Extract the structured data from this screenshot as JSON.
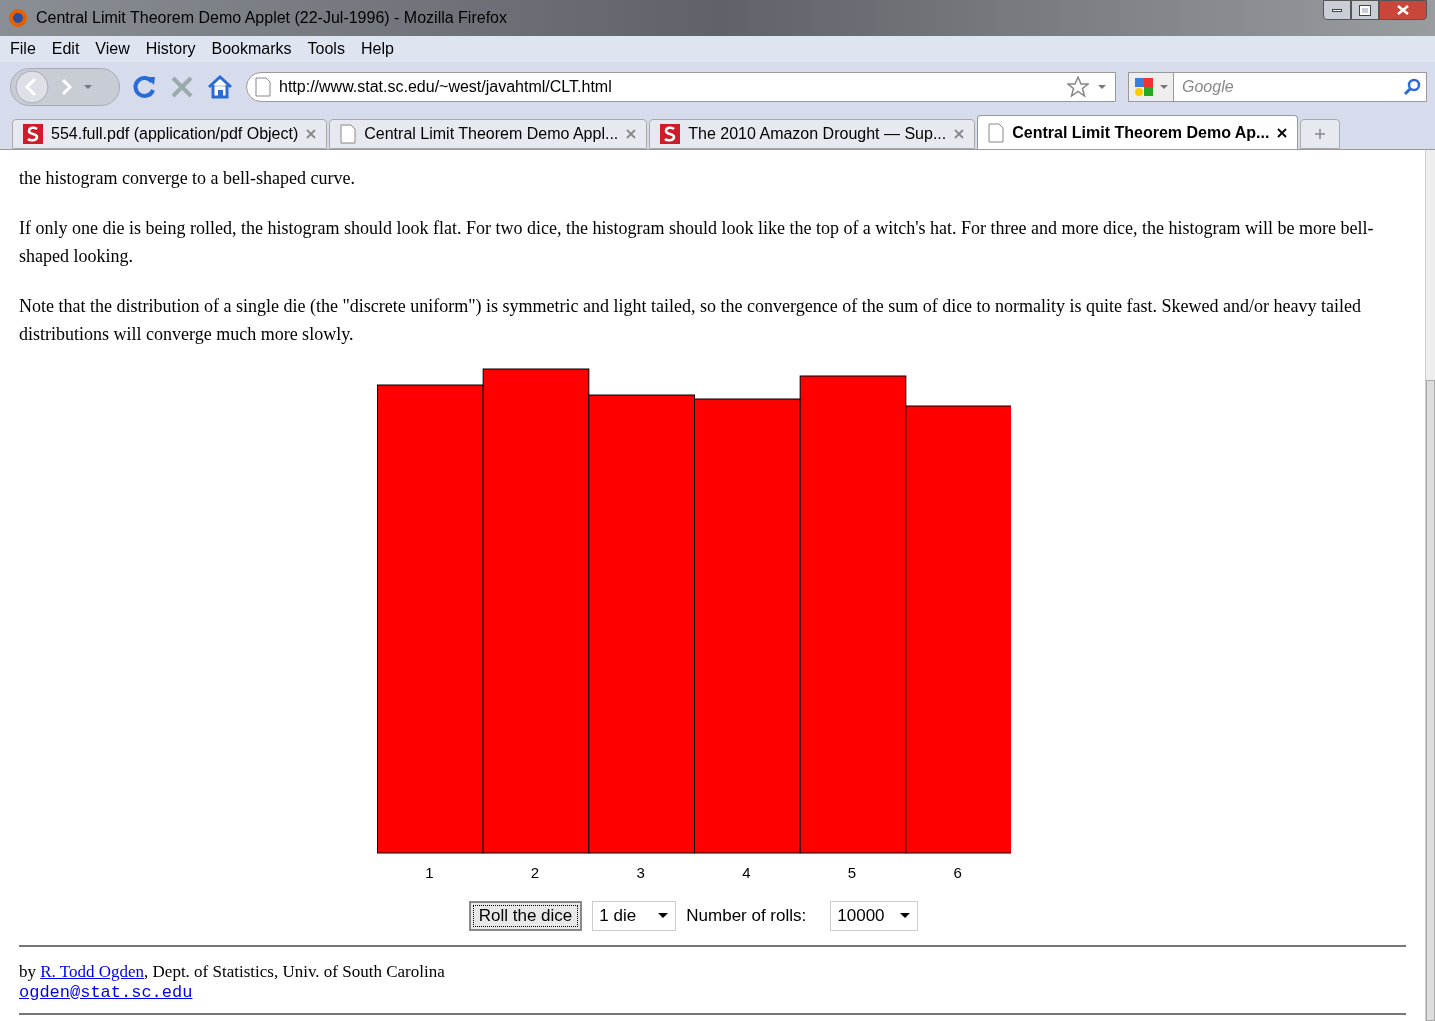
{
  "window": {
    "title": "Central Limit Theorem Demo Applet (22-Jul-1996) - Mozilla Firefox"
  },
  "menu": [
    "File",
    "Edit",
    "View",
    "History",
    "Bookmarks",
    "Tools",
    "Help"
  ],
  "address_bar": {
    "value": "http://www.stat.sc.edu/~west/javahtml/CLT.html"
  },
  "search": {
    "placeholder": "Google"
  },
  "tabs": [
    {
      "label": "554.full.pdf (application/pdf Object)",
      "kind": "s",
      "selected": false
    },
    {
      "label": "Central Limit Theorem Demo Appl...",
      "kind": "page",
      "selected": false
    },
    {
      "label": "The 2010 Amazon Drought — Sup...",
      "kind": "s",
      "selected": false
    },
    {
      "label": "Central Limit Theorem Demo Ap...",
      "kind": "page",
      "selected": true
    }
  ],
  "content": {
    "paragraphs": [
      "the histogram converge to a bell-shaped curve.",
      "If only one die is being rolled, the histogram should look flat. For two dice, the histogram should look like the top of a witch's hat. For three and more dice, the histogram will be more bell-shaped looking.",
      "Note that the distribution of a single die (the \"discrete uniform\") is symmetric and light tailed, so the convergence of the sum of dice to normality is quite fast. Skewed and/or heavy tailed distributions will converge much more slowly."
    ],
    "histogram": {
      "x_labels": [
        "1",
        "2",
        "3",
        "4",
        "5",
        "6"
      ]
    },
    "controls": {
      "button": "Roll the dice",
      "dice_select": "1 die",
      "rolls_label": "Number of rolls:",
      "rolls_select": "10000"
    },
    "footer": {
      "by": "by",
      "author": "R. Todd Ogden",
      "affiliation": ", Dept. of Statistics, Univ. of South Carolina",
      "email": "ogden@stat.sc.edu"
    }
  }
}
